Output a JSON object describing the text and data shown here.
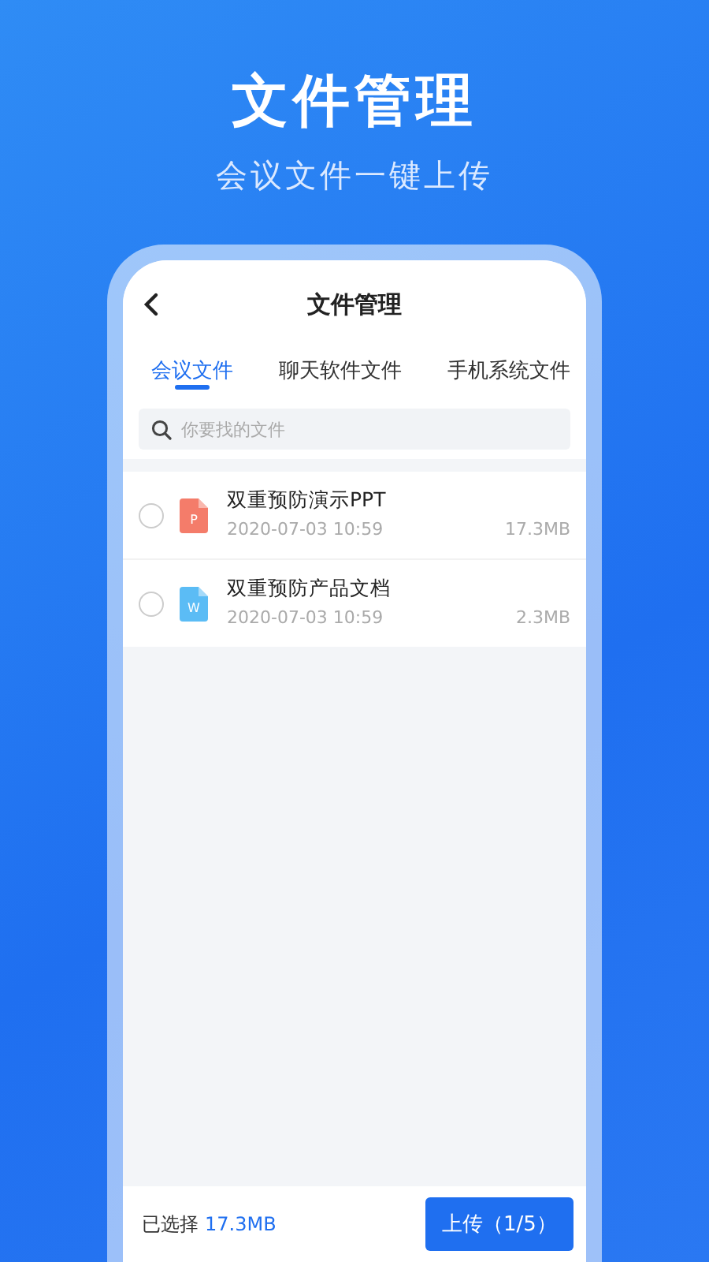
{
  "headline": {
    "title": "文件管理",
    "subtitle": "会议文件一键上传"
  },
  "app": {
    "title": "文件管理",
    "tabs": [
      {
        "label": "会议文件",
        "selected": true
      },
      {
        "label": "聊天软件文件",
        "selected": false
      },
      {
        "label": "手机系统文件",
        "selected": false
      }
    ],
    "search": {
      "placeholder": "你要找的文件"
    },
    "files": [
      {
        "kind": "ppt",
        "badge": "P",
        "name": "双重预防演示PPT",
        "date": "2020-07-03 10:59",
        "size": "17.3MB",
        "selected": false
      },
      {
        "kind": "word",
        "badge": "W",
        "name": "双重预防产品文档",
        "date": "2020-07-03 10:59",
        "size": "2.3MB",
        "selected": false
      }
    ],
    "footer": {
      "label": "已选择",
      "size": "17.3MB",
      "button": "上传（1/5）"
    }
  }
}
